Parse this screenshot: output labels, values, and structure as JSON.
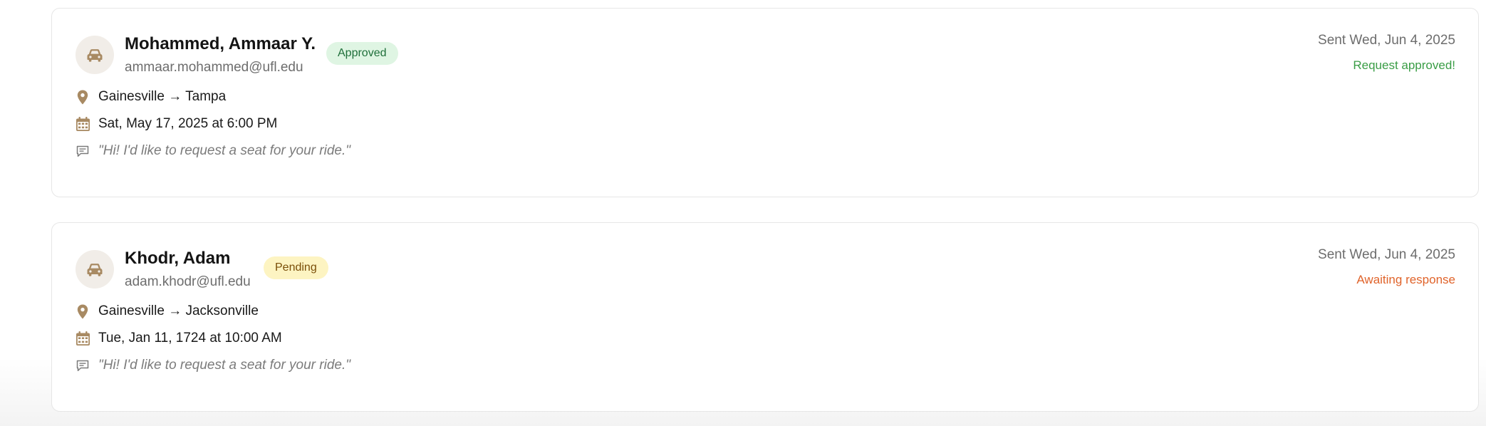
{
  "requests": [
    {
      "name": "Mohammed, Ammaar Y.",
      "email": "ammaar.mohammed@ufl.edu",
      "status_badge": "Approved",
      "sent": "Sent Wed, Jun 4, 2025",
      "status_text": "Request approved!",
      "route": "Gainesville → Tampa",
      "datetime": "Sat, May 17, 2025 at 6:00 PM",
      "message": "\"Hi! I'd like to request a seat for your ride.\""
    },
    {
      "name": "Khodr, Adam",
      "email": "adam.khodr@ufl.edu",
      "status_badge": "Pending",
      "sent": "Sent Wed, Jun 4, 2025",
      "status_text": "Awaiting response",
      "route": "Gainesville → Jacksonville",
      "datetime": "Tue, Jan 11, 1724 at 10:00 AM",
      "message": "\"Hi! I'd like to request a seat for your ride.\""
    }
  ],
  "icons": {
    "avatar": "car-icon",
    "route": "location-pin-icon",
    "date": "calendar-icon",
    "message": "message-icon"
  },
  "colors": {
    "icon_brown": "#a88a63",
    "approved_bg": "#dff5e3",
    "approved_text": "#1f6f3a",
    "pending_bg": "#fdf4c2",
    "pending_text": "#7a4e08",
    "status_approved": "#3a9d46",
    "status_awaiting": "#e0632a"
  }
}
